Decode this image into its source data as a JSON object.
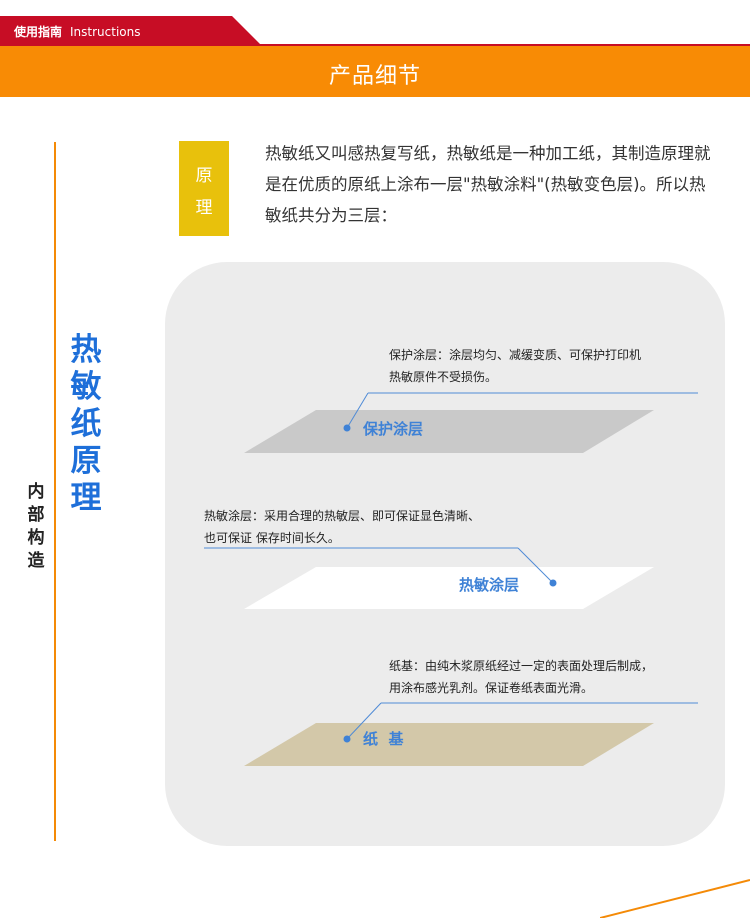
{
  "tab": {
    "label": "使用指南",
    "label_en": "Instructions",
    "color": "#c70d25"
  },
  "header": {
    "title": "产品细节",
    "color": "#f88b05"
  },
  "side": {
    "big_title_chars": [
      "热",
      "敏",
      "纸",
      "原",
      "理"
    ],
    "small_title_chars": [
      "内",
      "部",
      "构",
      "造"
    ],
    "accent_color": "#1e6fd9"
  },
  "principle": {
    "badge_chars": [
      "原",
      "理"
    ],
    "text": "热敏纸又叫感热复写纸，热敏纸是一种加工纸，其制造原理就是在优质的原纸上涂布一层\"热敏涂料\"(热敏变色层)。所以热敏纸共分为三层："
  },
  "layers": [
    {
      "label": "保护涂层",
      "desc_lines": [
        "保护涂层：涂层均匀、减缓变质、可保护打印机",
        "热敏原件不受损伤。"
      ],
      "color": "#c9c9c9"
    },
    {
      "label": "热敏涂层",
      "desc_lines": [
        "热敏涂层：采用合理的热敏层、即可保证显色清晰、",
        "也可保证 保存时间长久。"
      ],
      "color": "#ffffff"
    },
    {
      "label": "纸  基",
      "desc_lines": [
        "纸基：由纯木浆原纸经过一定的表面处理后制成，",
        "用涂布感光乳剂。保证卷纸表面光滑。"
      ],
      "color": "#d3c8a9"
    }
  ]
}
